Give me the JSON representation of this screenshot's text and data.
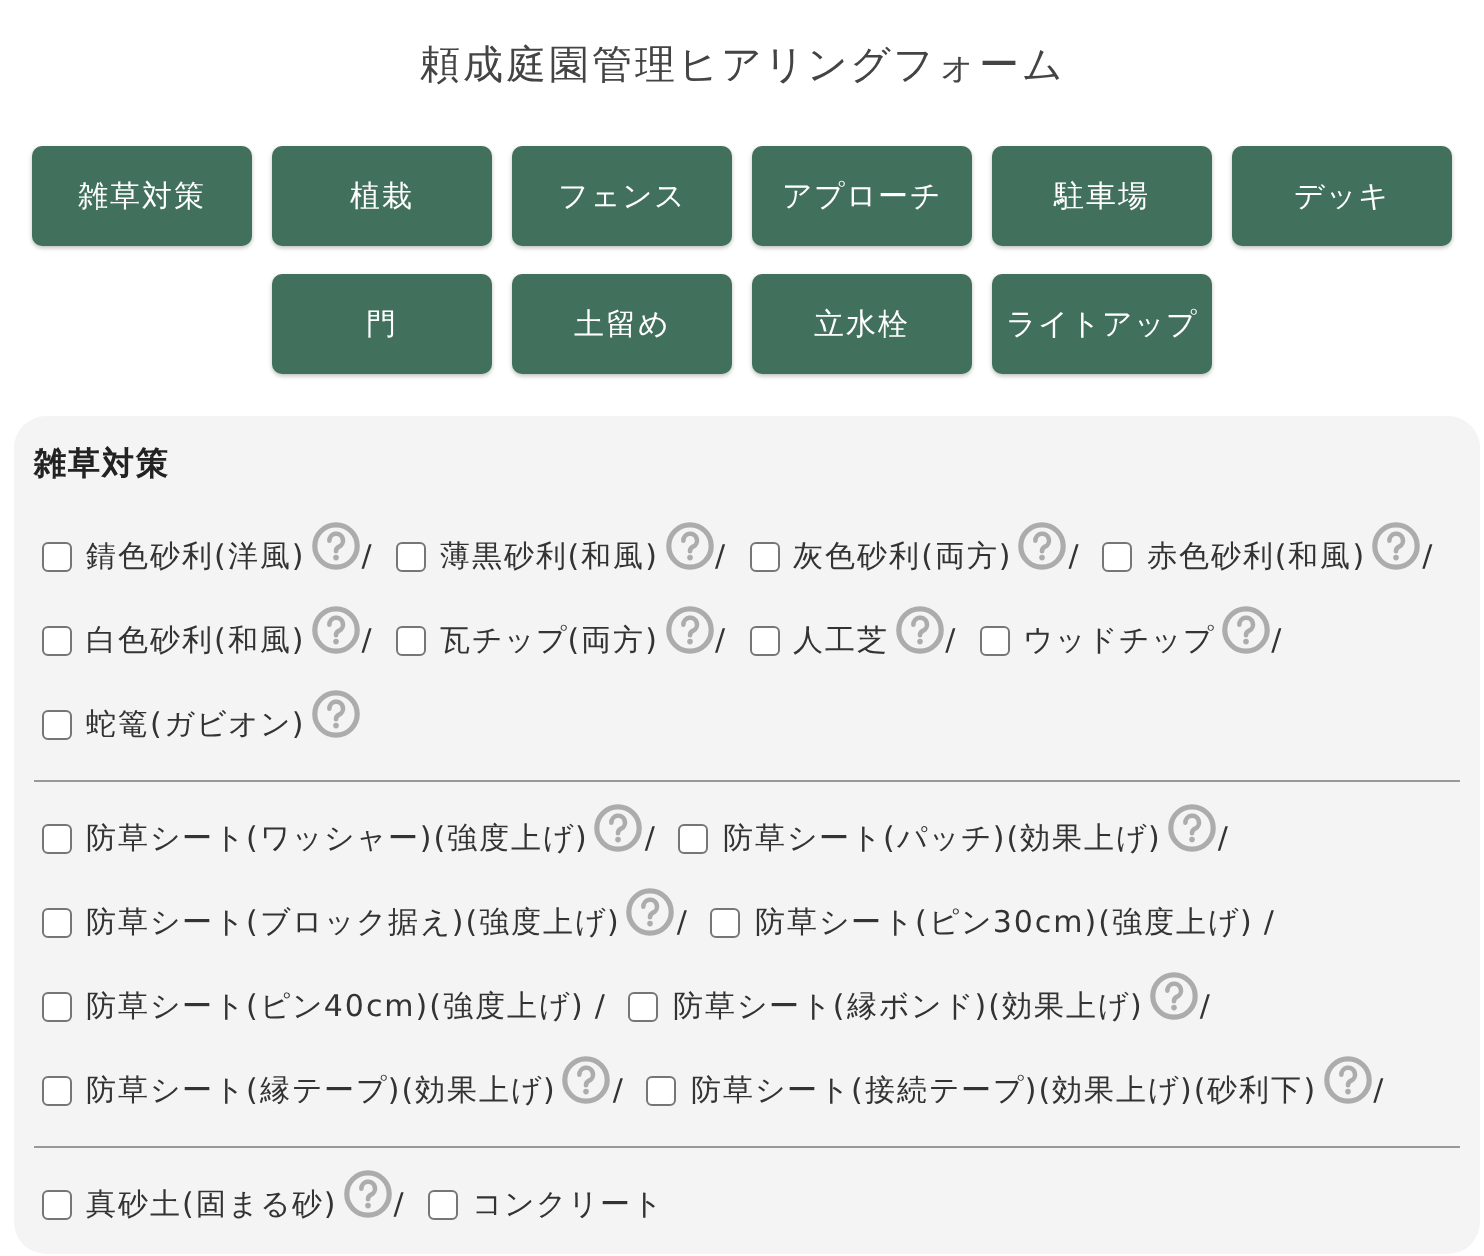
{
  "title": "頼成庭園管理ヒアリングフォーム",
  "category_buttons": [
    "雑草対策",
    "植栽",
    "フェンス",
    "アプローチ",
    "駐車場",
    "デッキ",
    "門",
    "土留め",
    "立水栓",
    "ライトアップ"
  ],
  "section": {
    "heading": "雑草対策",
    "groups": [
      {
        "items": [
          {
            "label": "錆色砂利(洋風)",
            "checked": false,
            "help": true,
            "separator": "/"
          },
          {
            "label": "薄黒砂利(和風)",
            "checked": false,
            "help": true,
            "separator": "/"
          },
          {
            "label": "灰色砂利(両方)",
            "checked": false,
            "help": true,
            "separator": "/"
          },
          {
            "label": "赤色砂利(和風)",
            "checked": false,
            "help": true,
            "separator": "/"
          },
          {
            "label": "白色砂利(和風)",
            "checked": false,
            "help": true,
            "separator": "/"
          },
          {
            "label": "瓦チップ(両方)",
            "checked": false,
            "help": true,
            "separator": "/"
          },
          {
            "label": "人工芝",
            "checked": false,
            "help": true,
            "separator": "/"
          },
          {
            "label": "ウッドチップ",
            "checked": false,
            "help": true,
            "separator": "/"
          },
          {
            "label": "蛇篭(ガビオン)",
            "checked": false,
            "help": true
          }
        ]
      },
      {
        "items": [
          {
            "label": "防草シート(ワッシャー)(強度上げ)",
            "checked": false,
            "help": true,
            "separator": "/"
          },
          {
            "label": "防草シート(パッチ)(効果上げ)",
            "checked": false,
            "help": true,
            "separator": "/"
          },
          {
            "label": "防草シート(ブロック据え)(強度上げ)",
            "checked": false,
            "help": true,
            "separator": "/"
          },
          {
            "label": "防草シート(ピン30cm)(強度上げ)",
            "checked": false,
            "help": false,
            "separator": "/"
          },
          {
            "label": "防草シート(ピン40cm)(強度上げ)",
            "checked": false,
            "help": false,
            "separator": "/"
          },
          {
            "label": "防草シート(縁ボンド)(効果上げ)",
            "checked": false,
            "help": true,
            "separator": "/"
          },
          {
            "label": "防草シート(縁テープ)(効果上げ)",
            "checked": false,
            "help": true,
            "separator": "/"
          },
          {
            "label": "防草シート(接続テープ)(効果上げ)(砂利下)",
            "checked": false,
            "help": true,
            "separator": "/"
          }
        ]
      },
      {
        "items": [
          {
            "label": "真砂土(固まる砂)",
            "checked": false,
            "help": true,
            "separator": "/"
          },
          {
            "label": "コンクリート",
            "checked": false,
            "help": false
          }
        ]
      }
    ]
  }
}
